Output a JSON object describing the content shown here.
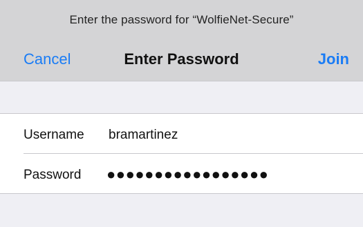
{
  "dialog": {
    "prompt": "Enter the password for “WolfieNet-Secure”",
    "title": "Enter Password",
    "cancel_label": "Cancel",
    "join_label": "Join",
    "accent_color": "#1a7cf5"
  },
  "form": {
    "username": {
      "label": "Username",
      "value": "bramartinez"
    },
    "password": {
      "label": "Password",
      "value": "●●●●●●●●●●●●●●●●●"
    }
  }
}
